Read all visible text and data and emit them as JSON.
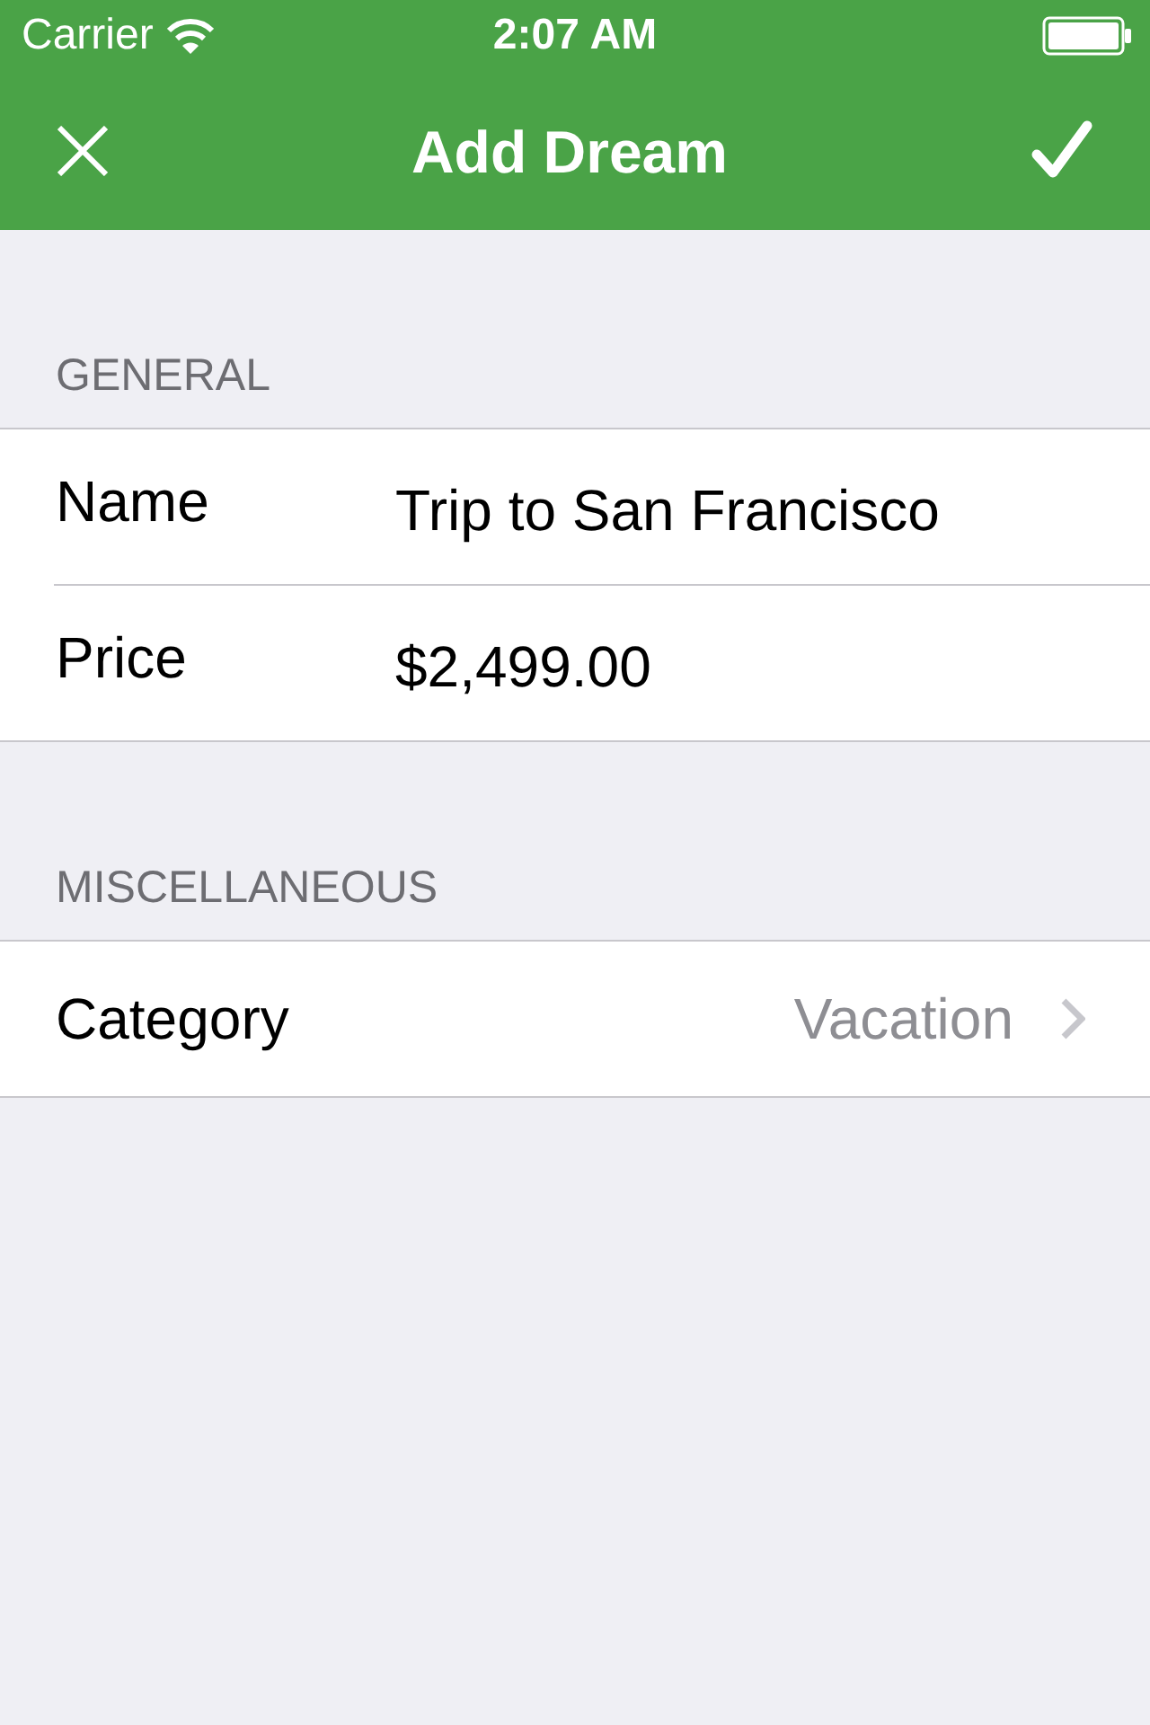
{
  "status_bar": {
    "carrier": "Carrier",
    "time": "2:07 AM"
  },
  "nav_bar": {
    "title": "Add Dream"
  },
  "sections": [
    {
      "header": "GENERAL",
      "rows": [
        {
          "kind": "field",
          "label": "Name",
          "value": "Trip to San Francisco"
        },
        {
          "kind": "field",
          "label": "Price",
          "value": "$2,499.00"
        }
      ]
    },
    {
      "header": "MISCELLANEOUS",
      "rows": [
        {
          "kind": "disclosure",
          "label": "Category",
          "value": "Vacation"
        }
      ]
    }
  ]
}
